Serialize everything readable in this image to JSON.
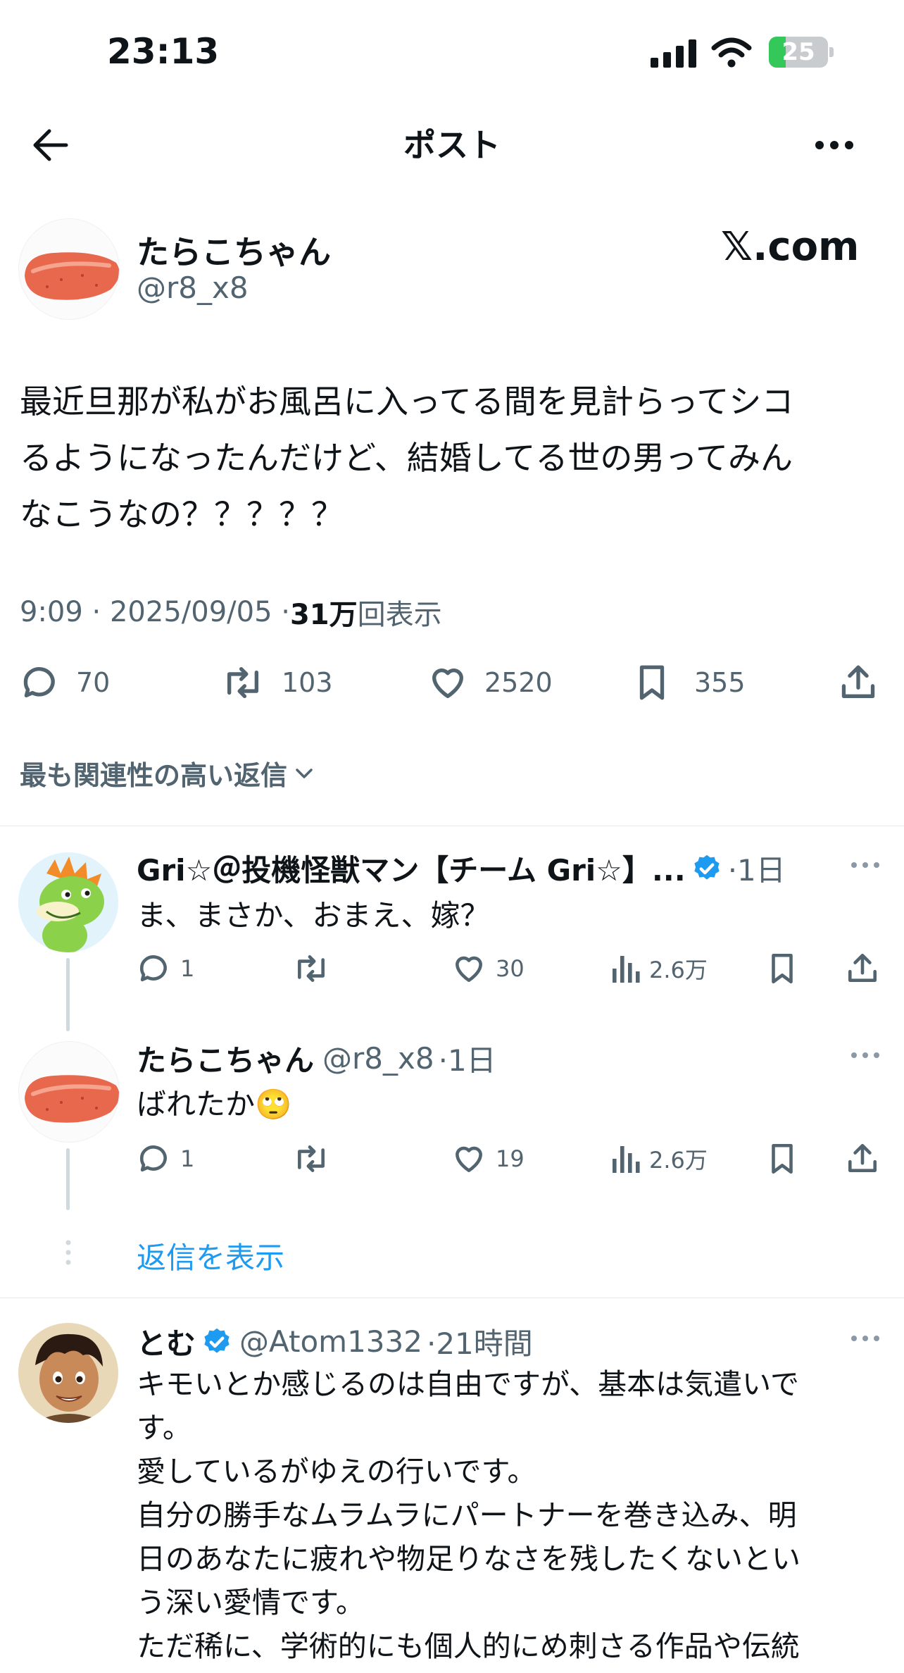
{
  "status_bar": {
    "time": "23:13",
    "battery": "25"
  },
  "header": {
    "title": "ポスト"
  },
  "post": {
    "display_name": "たらこちゃん",
    "handle": "@r8_x8",
    "watermark": "𝕏.com",
    "text_lines": [
      "最近旦那が私がお風呂に入ってる間を見計らってシコ",
      "るようになったんだけど、結婚してる世の男ってみん",
      "なこうなの？？？？？"
    ],
    "meta_time": "9:09 · 2025/09/05 · ",
    "views_count": "31万",
    "views_label": "回表示",
    "replies": "70",
    "reposts": "103",
    "likes": "2520",
    "bookmarks": "355"
  },
  "sort": {
    "label": "最も関連性の高い返信"
  },
  "replies": [
    {
      "display_name": "Gri☆＠投機怪獣マン【チーム Gri☆】...",
      "verified": true,
      "handle": "",
      "time": "·1日",
      "text": "ま、まさか、おまえ、嫁？",
      "replies": "1",
      "reposts": "",
      "likes": "30",
      "views": "2.6万"
    },
    {
      "display_name": "たらこちゃん",
      "verified": false,
      "handle": "@r8_x8",
      "time": "·1日",
      "text": "ばれたか🙄",
      "replies": "1",
      "reposts": "",
      "likes": "19",
      "views": "2.6万"
    }
  ],
  "show_replies": {
    "label": "返信を表示"
  },
  "reply3": {
    "display_name": "とむ",
    "verified": true,
    "handle": "@Atom1332",
    "time": "·21時間",
    "text_lines": [
      "キモいとか感じるのは自由ですが、基本は気遣いで",
      "す。",
      "愛しているがゆえの行いです。",
      "自分の勝手なムラムラにパートナーを巻き込み、明",
      "日のあなたに疲れや物足りなさを残したくないとい",
      "う深い愛情です。",
      "ただ稀に、学術的にも個人的にめ刺さる作品や伝統"
    ]
  },
  "colors": {
    "accent": "#1d9bf0",
    "muted": "#536471",
    "battery": "#34c759"
  }
}
